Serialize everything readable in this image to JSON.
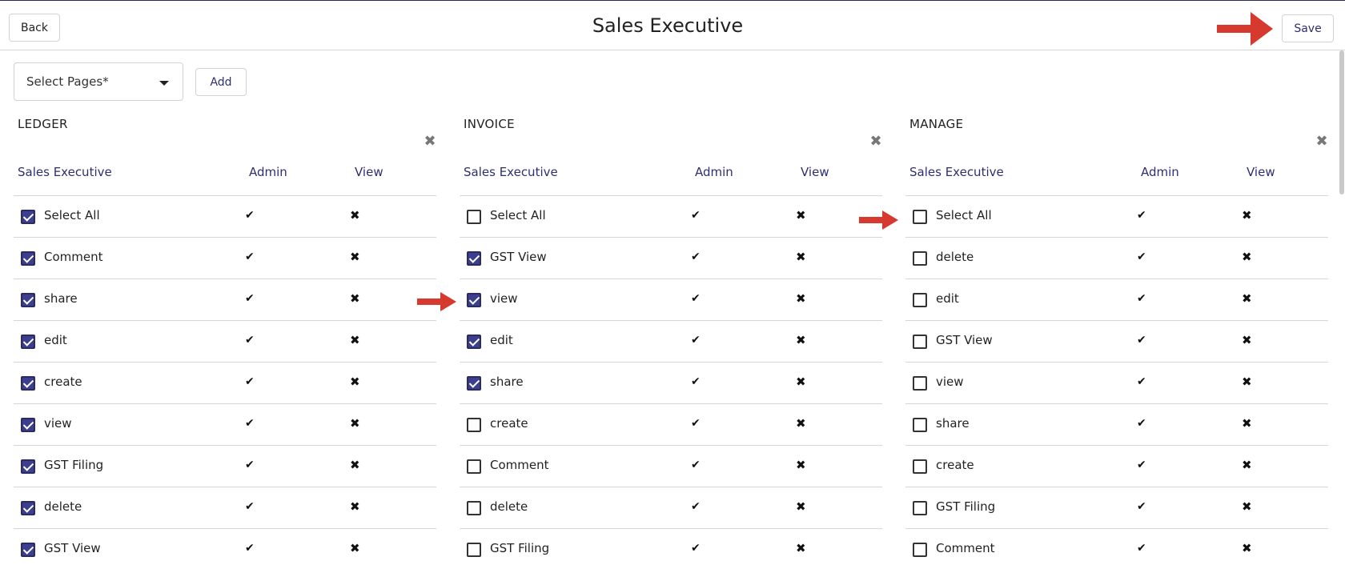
{
  "header": {
    "back_label": "Back",
    "title": "Sales Executive",
    "save_label": "Save"
  },
  "toolbar": {
    "select_placeholder": "Select Pages*",
    "add_label": "Add"
  },
  "sections": [
    {
      "title": "LEDGER",
      "columns": [
        "Sales Executive",
        "Admin",
        "View"
      ],
      "rows": [
        {
          "label": "Select All",
          "checked": true
        },
        {
          "label": "Comment",
          "checked": true
        },
        {
          "label": "share",
          "checked": true
        },
        {
          "label": "edit",
          "checked": true
        },
        {
          "label": "create",
          "checked": true
        },
        {
          "label": "view",
          "checked": true
        },
        {
          "label": "GST Filing",
          "checked": true
        },
        {
          "label": "delete",
          "checked": true
        },
        {
          "label": "GST View",
          "checked": true
        }
      ]
    },
    {
      "title": "INVOICE",
      "columns": [
        "Sales Executive",
        "Admin",
        "View"
      ],
      "rows": [
        {
          "label": "Select All",
          "checked": false
        },
        {
          "label": "GST View",
          "checked": true
        },
        {
          "label": "view",
          "checked": true
        },
        {
          "label": "edit",
          "checked": true
        },
        {
          "label": "share",
          "checked": true
        },
        {
          "label": "create",
          "checked": false
        },
        {
          "label": "Comment",
          "checked": false
        },
        {
          "label": "delete",
          "checked": false
        },
        {
          "label": "GST Filing",
          "checked": false
        }
      ]
    },
    {
      "title": "MANAGE",
      "columns": [
        "Sales Executive",
        "Admin",
        "View"
      ],
      "rows": [
        {
          "label": "Select All",
          "checked": false
        },
        {
          "label": "delete",
          "checked": false
        },
        {
          "label": "edit",
          "checked": false
        },
        {
          "label": "GST View",
          "checked": false
        },
        {
          "label": "view",
          "checked": false
        },
        {
          "label": "share",
          "checked": false
        },
        {
          "label": "create",
          "checked": false
        },
        {
          "label": "GST Filing",
          "checked": false
        },
        {
          "label": "Comment",
          "checked": false
        }
      ]
    }
  ],
  "icons": {
    "admin_mark": "checkmark-icon",
    "view_mark": "cross-icon",
    "remove": "close-icon",
    "annotation": "red-arrow-icon"
  },
  "colors": {
    "accent": "#2e2f72",
    "checkbox_checked": "#3d3f8e",
    "arrow": "#d63a2f"
  }
}
